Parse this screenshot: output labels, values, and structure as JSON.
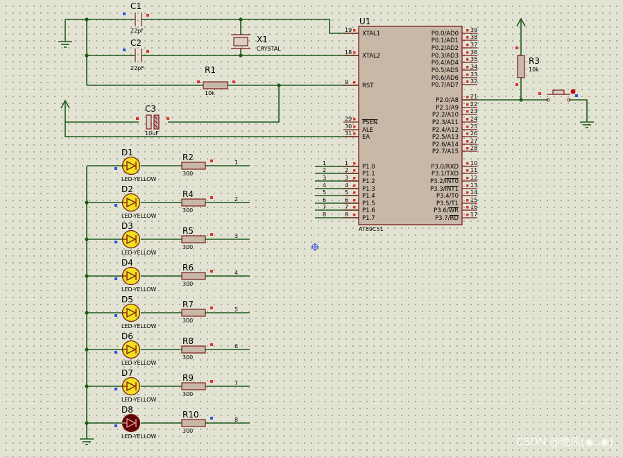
{
  "mcu": {
    "ref": "U1",
    "part": "AT89C51",
    "left_pins": [
      {
        "num": "19",
        "name": "XTAL1"
      },
      {
        "num": "18",
        "name": "XTAL2"
      },
      {
        "num": "9",
        "name": "RST"
      },
      {
        "num": "29",
        "name": "PSEN"
      },
      {
        "num": "30",
        "name": "ALE"
      },
      {
        "num": "31",
        "name": "EA"
      },
      {
        "num": "1",
        "name": "P1.0"
      },
      {
        "num": "2",
        "name": "P1.1"
      },
      {
        "num": "3",
        "name": "P1.2"
      },
      {
        "num": "4",
        "name": "P1.3"
      },
      {
        "num": "5",
        "name": "P1.4"
      },
      {
        "num": "6",
        "name": "P1.5"
      },
      {
        "num": "7",
        "name": "P1.6"
      },
      {
        "num": "8",
        "name": "P1.7"
      }
    ],
    "right_pins": [
      {
        "num": "39",
        "name": "P0.0/AD0"
      },
      {
        "num": "38",
        "name": "P0.1/AD1"
      },
      {
        "num": "37",
        "name": "P0.2/AD2"
      },
      {
        "num": "36",
        "name": "P0.3/AD3"
      },
      {
        "num": "35",
        "name": "P0.4/AD4"
      },
      {
        "num": "34",
        "name": "P0.5/AD5"
      },
      {
        "num": "33",
        "name": "P0.6/AD6"
      },
      {
        "num": "32",
        "name": "P0.7/AD7"
      },
      {
        "num": "21",
        "name": "P2.0/A8"
      },
      {
        "num": "22",
        "name": "P2.1/A9"
      },
      {
        "num": "23",
        "name": "P2.2/A10"
      },
      {
        "num": "24",
        "name": "P2.3/A11"
      },
      {
        "num": "25",
        "name": "P2.4/A12"
      },
      {
        "num": "26",
        "name": "P2.5/A13"
      },
      {
        "num": "27",
        "name": "P2.6/A14"
      },
      {
        "num": "28",
        "name": "P2.7/A15"
      },
      {
        "num": "10",
        "name": "P3.0/RXD"
      },
      {
        "num": "11",
        "name": "P3.1/TXD"
      },
      {
        "num": "12",
        "name": "P3.2/INT0"
      },
      {
        "num": "13",
        "name": "P3.3/INT1"
      },
      {
        "num": "14",
        "name": "P3.4/T0"
      },
      {
        "num": "15",
        "name": "P3.5/T1"
      },
      {
        "num": "16",
        "name": "P3.6/WR"
      },
      {
        "num": "17",
        "name": "P3.7/RD"
      }
    ]
  },
  "components": {
    "c1": {
      "ref": "C1",
      "value": "22pf"
    },
    "c2": {
      "ref": "C2",
      "value": "22pF"
    },
    "c3": {
      "ref": "C3",
      "value": "10uF"
    },
    "x1": {
      "ref": "X1",
      "value": "CRYSTAL"
    },
    "r1": {
      "ref": "R1",
      "value": "10k"
    },
    "r3": {
      "ref": "R3",
      "value": "10k"
    }
  },
  "p1_net_labels": [
    "1",
    "2",
    "3",
    "4",
    "5",
    "6",
    "7",
    "8"
  ],
  "led_rows": [
    {
      "led": "D1",
      "led_type": "LED-YELLOW",
      "res": "R2",
      "res_value": "300",
      "net": "1",
      "lit": true
    },
    {
      "led": "D2",
      "led_type": "LED-YELLOW",
      "res": "R4",
      "res_value": "300",
      "net": "2",
      "lit": true
    },
    {
      "led": "D3",
      "led_type": "LED-YELLOW",
      "res": "R5",
      "res_value": "300",
      "net": "3",
      "lit": true
    },
    {
      "led": "D4",
      "led_type": "LED-YELLOW",
      "res": "R6",
      "res_value": "300",
      "net": "4",
      "lit": true
    },
    {
      "led": "D5",
      "led_type": "LED-YELLOW",
      "res": "R7",
      "res_value": "300",
      "net": "5",
      "lit": true
    },
    {
      "led": "D6",
      "led_type": "LED-YELLOW",
      "res": "R8",
      "res_value": "300",
      "net": "6",
      "lit": true
    },
    {
      "led": "D7",
      "led_type": "LED-YELLOW",
      "res": "R9",
      "res_value": "300",
      "net": "7",
      "lit": true
    },
    {
      "led": "D8",
      "led_type": "LED-YELLOW",
      "res": "R10",
      "res_value": "300",
      "net": "8",
      "lit": false
    }
  ],
  "colors": {
    "wire": "#1a5a1a",
    "component_outline": "#7a1a1a",
    "ic_fill": "#c8b8a8",
    "led_lit": "#f0e020",
    "led_off": "#600000",
    "pin_low": "#3050e0",
    "pin_high": "#e03030"
  },
  "watermark": "CSDN @晚风(◉ᴗ◉)"
}
